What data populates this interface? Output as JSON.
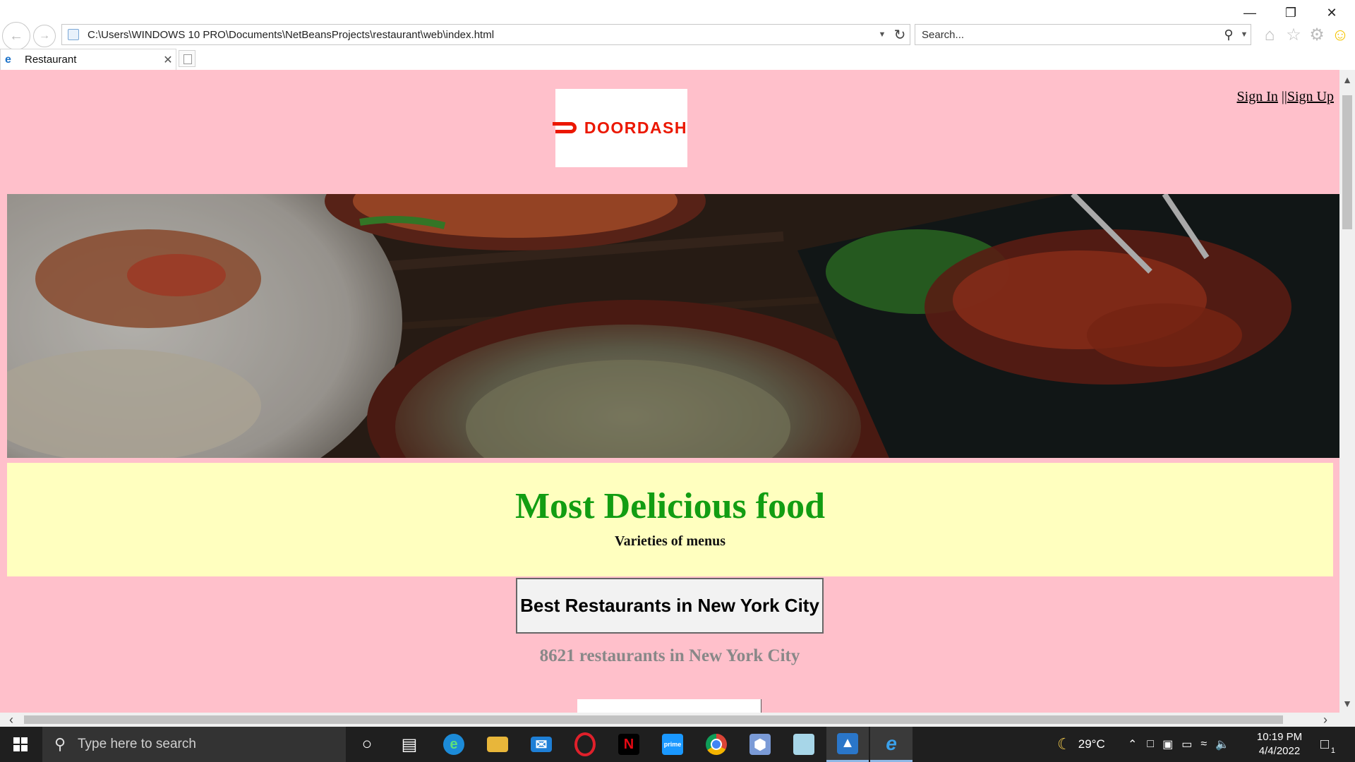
{
  "window": {
    "minimize": "—",
    "restore": "❐",
    "close": "✕"
  },
  "browser": {
    "back_icon": "back-arrow-icon",
    "forward_icon": "forward-arrow-icon",
    "address": "C:\\Users\\WINDOWS 10 PRO\\Documents\\NetBeansProjects\\restaurant\\web\\index.html",
    "search_placeholder": "Search...",
    "tab_title": "Restaurant",
    "toolbar_icons": [
      "home-icon",
      "favorites-star-icon",
      "settings-gear-icon",
      "feedback-smiley-icon"
    ]
  },
  "page": {
    "logo_text": "DOORDASH",
    "sign_in": "Sign In",
    "separator": "||",
    "sign_up": "Sign Up",
    "headline": "Most Delicious food",
    "subheadline": "Varieties of menus",
    "cta_button": "Best Restaurants in New York City",
    "restaurant_count": "8621 restaurants in New York City",
    "colors": {
      "background": "#ffc0cb",
      "banner": "#ffffbf",
      "headline": "#129d12",
      "logo": "#eb1700"
    }
  },
  "taskbar": {
    "search_placeholder": "Type here to search",
    "apps": [
      "cortana-icon",
      "task-view-icon",
      "edge-icon",
      "file-explorer-icon",
      "mail-icon",
      "opera-icon",
      "netflix-icon",
      "prime-video-icon",
      "chrome-icon",
      "box-app-icon",
      "notepad-icon",
      "photos-icon",
      "internet-explorer-icon"
    ],
    "weather": "29°C",
    "time": "10:19 PM",
    "date": "4/4/2022",
    "notifications": "1"
  }
}
